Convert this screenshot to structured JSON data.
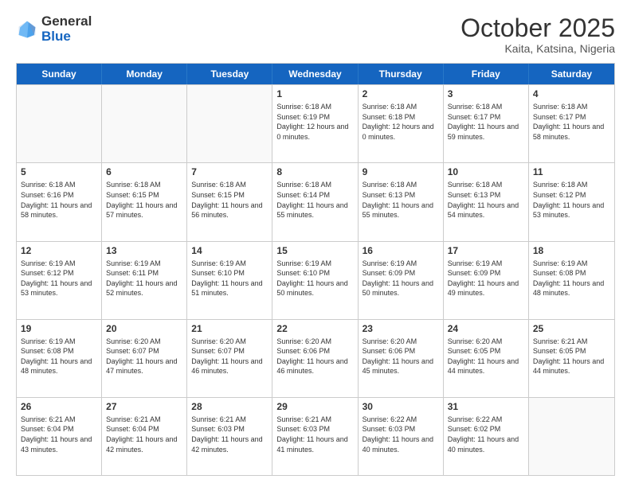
{
  "logo": {
    "general": "General",
    "blue": "Blue"
  },
  "header": {
    "title": "October 2025",
    "subtitle": "Kaita, Katsina, Nigeria"
  },
  "weekdays": [
    "Sunday",
    "Monday",
    "Tuesday",
    "Wednesday",
    "Thursday",
    "Friday",
    "Saturday"
  ],
  "weeks": [
    [
      {
        "day": "",
        "sunrise": "",
        "sunset": "",
        "daylight": ""
      },
      {
        "day": "",
        "sunrise": "",
        "sunset": "",
        "daylight": ""
      },
      {
        "day": "",
        "sunrise": "",
        "sunset": "",
        "daylight": ""
      },
      {
        "day": "1",
        "sunrise": "Sunrise: 6:18 AM",
        "sunset": "Sunset: 6:19 PM",
        "daylight": "Daylight: 12 hours and 0 minutes."
      },
      {
        "day": "2",
        "sunrise": "Sunrise: 6:18 AM",
        "sunset": "Sunset: 6:18 PM",
        "daylight": "Daylight: 12 hours and 0 minutes."
      },
      {
        "day": "3",
        "sunrise": "Sunrise: 6:18 AM",
        "sunset": "Sunset: 6:17 PM",
        "daylight": "Daylight: 11 hours and 59 minutes."
      },
      {
        "day": "4",
        "sunrise": "Sunrise: 6:18 AM",
        "sunset": "Sunset: 6:17 PM",
        "daylight": "Daylight: 11 hours and 58 minutes."
      }
    ],
    [
      {
        "day": "5",
        "sunrise": "Sunrise: 6:18 AM",
        "sunset": "Sunset: 6:16 PM",
        "daylight": "Daylight: 11 hours and 58 minutes."
      },
      {
        "day": "6",
        "sunrise": "Sunrise: 6:18 AM",
        "sunset": "Sunset: 6:15 PM",
        "daylight": "Daylight: 11 hours and 57 minutes."
      },
      {
        "day": "7",
        "sunrise": "Sunrise: 6:18 AM",
        "sunset": "Sunset: 6:15 PM",
        "daylight": "Daylight: 11 hours and 56 minutes."
      },
      {
        "day": "8",
        "sunrise": "Sunrise: 6:18 AM",
        "sunset": "Sunset: 6:14 PM",
        "daylight": "Daylight: 11 hours and 55 minutes."
      },
      {
        "day": "9",
        "sunrise": "Sunrise: 6:18 AM",
        "sunset": "Sunset: 6:13 PM",
        "daylight": "Daylight: 11 hours and 55 minutes."
      },
      {
        "day": "10",
        "sunrise": "Sunrise: 6:18 AM",
        "sunset": "Sunset: 6:13 PM",
        "daylight": "Daylight: 11 hours and 54 minutes."
      },
      {
        "day": "11",
        "sunrise": "Sunrise: 6:18 AM",
        "sunset": "Sunset: 6:12 PM",
        "daylight": "Daylight: 11 hours and 53 minutes."
      }
    ],
    [
      {
        "day": "12",
        "sunrise": "Sunrise: 6:19 AM",
        "sunset": "Sunset: 6:12 PM",
        "daylight": "Daylight: 11 hours and 53 minutes."
      },
      {
        "day": "13",
        "sunrise": "Sunrise: 6:19 AM",
        "sunset": "Sunset: 6:11 PM",
        "daylight": "Daylight: 11 hours and 52 minutes."
      },
      {
        "day": "14",
        "sunrise": "Sunrise: 6:19 AM",
        "sunset": "Sunset: 6:10 PM",
        "daylight": "Daylight: 11 hours and 51 minutes."
      },
      {
        "day": "15",
        "sunrise": "Sunrise: 6:19 AM",
        "sunset": "Sunset: 6:10 PM",
        "daylight": "Daylight: 11 hours and 50 minutes."
      },
      {
        "day": "16",
        "sunrise": "Sunrise: 6:19 AM",
        "sunset": "Sunset: 6:09 PM",
        "daylight": "Daylight: 11 hours and 50 minutes."
      },
      {
        "day": "17",
        "sunrise": "Sunrise: 6:19 AM",
        "sunset": "Sunset: 6:09 PM",
        "daylight": "Daylight: 11 hours and 49 minutes."
      },
      {
        "day": "18",
        "sunrise": "Sunrise: 6:19 AM",
        "sunset": "Sunset: 6:08 PM",
        "daylight": "Daylight: 11 hours and 48 minutes."
      }
    ],
    [
      {
        "day": "19",
        "sunrise": "Sunrise: 6:19 AM",
        "sunset": "Sunset: 6:08 PM",
        "daylight": "Daylight: 11 hours and 48 minutes."
      },
      {
        "day": "20",
        "sunrise": "Sunrise: 6:20 AM",
        "sunset": "Sunset: 6:07 PM",
        "daylight": "Daylight: 11 hours and 47 minutes."
      },
      {
        "day": "21",
        "sunrise": "Sunrise: 6:20 AM",
        "sunset": "Sunset: 6:07 PM",
        "daylight": "Daylight: 11 hours and 46 minutes."
      },
      {
        "day": "22",
        "sunrise": "Sunrise: 6:20 AM",
        "sunset": "Sunset: 6:06 PM",
        "daylight": "Daylight: 11 hours and 46 minutes."
      },
      {
        "day": "23",
        "sunrise": "Sunrise: 6:20 AM",
        "sunset": "Sunset: 6:06 PM",
        "daylight": "Daylight: 11 hours and 45 minutes."
      },
      {
        "day": "24",
        "sunrise": "Sunrise: 6:20 AM",
        "sunset": "Sunset: 6:05 PM",
        "daylight": "Daylight: 11 hours and 44 minutes."
      },
      {
        "day": "25",
        "sunrise": "Sunrise: 6:21 AM",
        "sunset": "Sunset: 6:05 PM",
        "daylight": "Daylight: 11 hours and 44 minutes."
      }
    ],
    [
      {
        "day": "26",
        "sunrise": "Sunrise: 6:21 AM",
        "sunset": "Sunset: 6:04 PM",
        "daylight": "Daylight: 11 hours and 43 minutes."
      },
      {
        "day": "27",
        "sunrise": "Sunrise: 6:21 AM",
        "sunset": "Sunset: 6:04 PM",
        "daylight": "Daylight: 11 hours and 42 minutes."
      },
      {
        "day": "28",
        "sunrise": "Sunrise: 6:21 AM",
        "sunset": "Sunset: 6:03 PM",
        "daylight": "Daylight: 11 hours and 42 minutes."
      },
      {
        "day": "29",
        "sunrise": "Sunrise: 6:21 AM",
        "sunset": "Sunset: 6:03 PM",
        "daylight": "Daylight: 11 hours and 41 minutes."
      },
      {
        "day": "30",
        "sunrise": "Sunrise: 6:22 AM",
        "sunset": "Sunset: 6:03 PM",
        "daylight": "Daylight: 11 hours and 40 minutes."
      },
      {
        "day": "31",
        "sunrise": "Sunrise: 6:22 AM",
        "sunset": "Sunset: 6:02 PM",
        "daylight": "Daylight: 11 hours and 40 minutes."
      },
      {
        "day": "",
        "sunrise": "",
        "sunset": "",
        "daylight": ""
      }
    ]
  ]
}
